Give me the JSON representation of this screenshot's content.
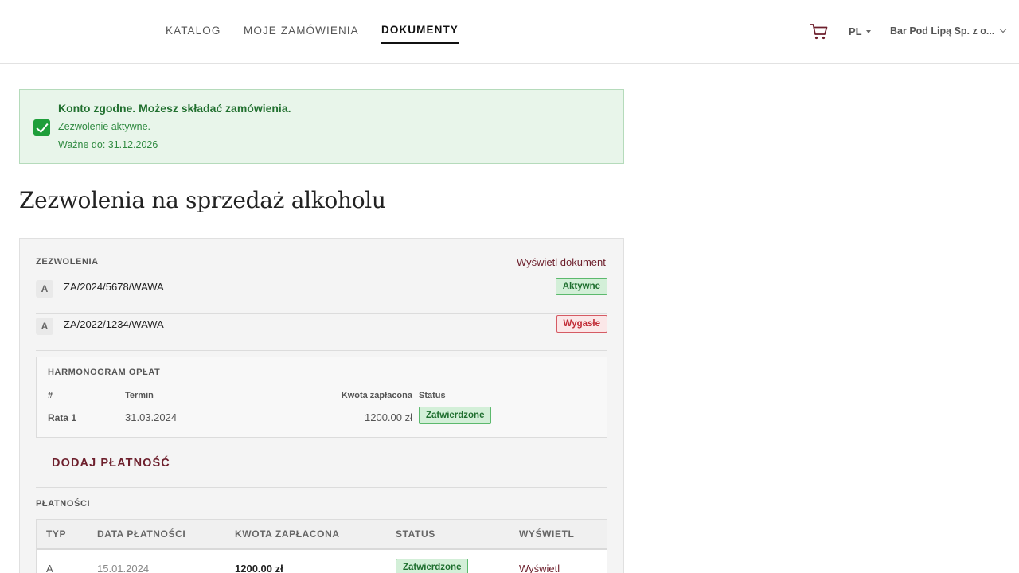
{
  "nav": {
    "items": [
      "KATALOG",
      "MOJE ZAMÓWIENIA",
      "DOKUMENTY"
    ],
    "active": "DOKUMENTY",
    "cart_icon": "cart-icon",
    "language": "PL",
    "account": "Bar Pod Lipą Sp. z o..."
  },
  "alert": {
    "title": "Konto zgodne. Możesz składać zamówienia.",
    "line1": "Zezwolenie aktywne.",
    "line2": "Ważne do: 31.12.2026",
    "icon": "check-icon",
    "color": "#1e9e3a"
  },
  "page_title": "Zezwolenia na sprzedaż alkoholu",
  "permits": {
    "section_label": "ZEZWOLENIA",
    "view_document": "Wyświetl dokument",
    "items": [
      {
        "type": "A",
        "number": "ZA/2024/5678/WAWA",
        "status": "Aktywne",
        "status_color": "#1e6e2e"
      },
      {
        "type": "A",
        "number": "ZA/2022/1234/WAWA",
        "status": "Wygasłe",
        "status_color": "#c12b36"
      }
    ]
  },
  "schedule": {
    "label": "HARMONOGRAM OPŁAT",
    "headers": [
      "#",
      "Termin",
      "Kwota zapłacona",
      "Status"
    ],
    "rows": [
      {
        "name": "Rata 1",
        "due": "31.03.2024",
        "amount": "1200.00 zł",
        "status": "Zatwierdzone"
      }
    ]
  },
  "add_payment": "DODAJ PŁATNOŚĆ",
  "payments": {
    "label": "PŁATNOŚCI",
    "headers": [
      "TYP",
      "DATA PŁATNOŚCI",
      "KWOTA ZAPŁACONA",
      "STATUS",
      "WYŚWIETL"
    ],
    "rows": [
      {
        "type": "A",
        "date": "15.01.2024",
        "amount": "1200.00 zł",
        "status": "Zatwierdzone",
        "view": "Wyświetl"
      }
    ]
  },
  "colors": {
    "accent": "#6d1f2c",
    "success": "#1e9e3a",
    "danger": "#c12b36"
  }
}
